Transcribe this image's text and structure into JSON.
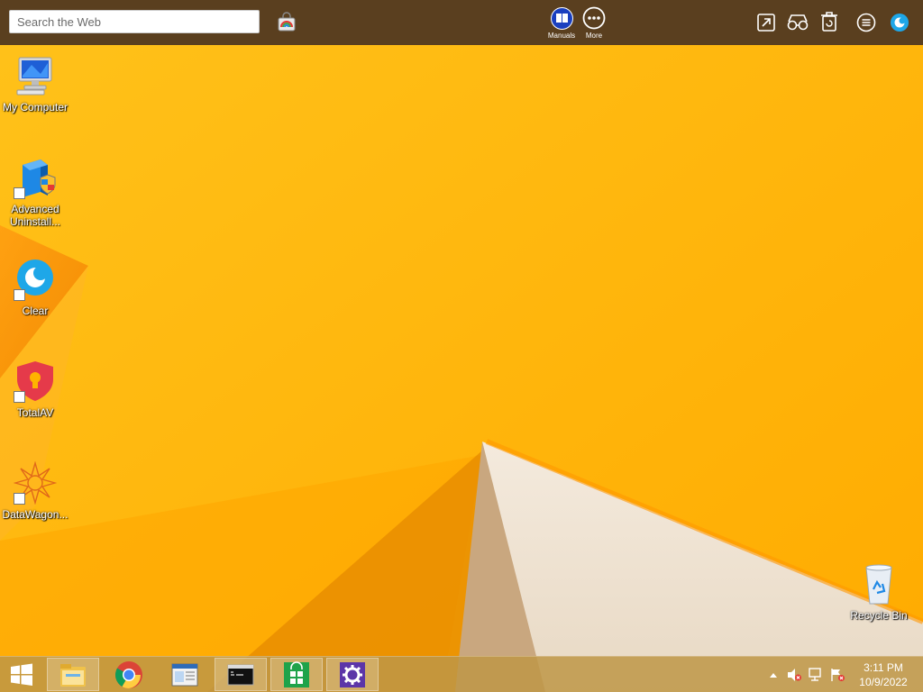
{
  "toolbar": {
    "search_placeholder": "Search the Web",
    "manuals_label": "Manuals",
    "more_label": "More"
  },
  "desktop": {
    "icons": [
      {
        "label": "My Computer",
        "icon": "my-computer-icon"
      },
      {
        "label": "Advanced\nUninstall...",
        "icon": "advanced-uninstaller-icon"
      },
      {
        "label": "Clear",
        "icon": "clear-icon"
      },
      {
        "label": "TotalAV",
        "icon": "totalav-icon"
      },
      {
        "label": "DataWagon...",
        "icon": "datawagon-icon"
      },
      {
        "label": "Recycle Bin",
        "icon": "recycle-bin-icon"
      }
    ]
  },
  "taskbar": {
    "clock": {
      "time": "3:11 PM",
      "date": "10/9/2022"
    },
    "apps": [
      "file-explorer",
      "chrome",
      "notepad-window",
      "command-prompt",
      "store",
      "settings"
    ]
  },
  "colors": {
    "wallpaper": "#ffb300",
    "toolbar": "#5a3f1f",
    "taskbar": "#be9646"
  }
}
